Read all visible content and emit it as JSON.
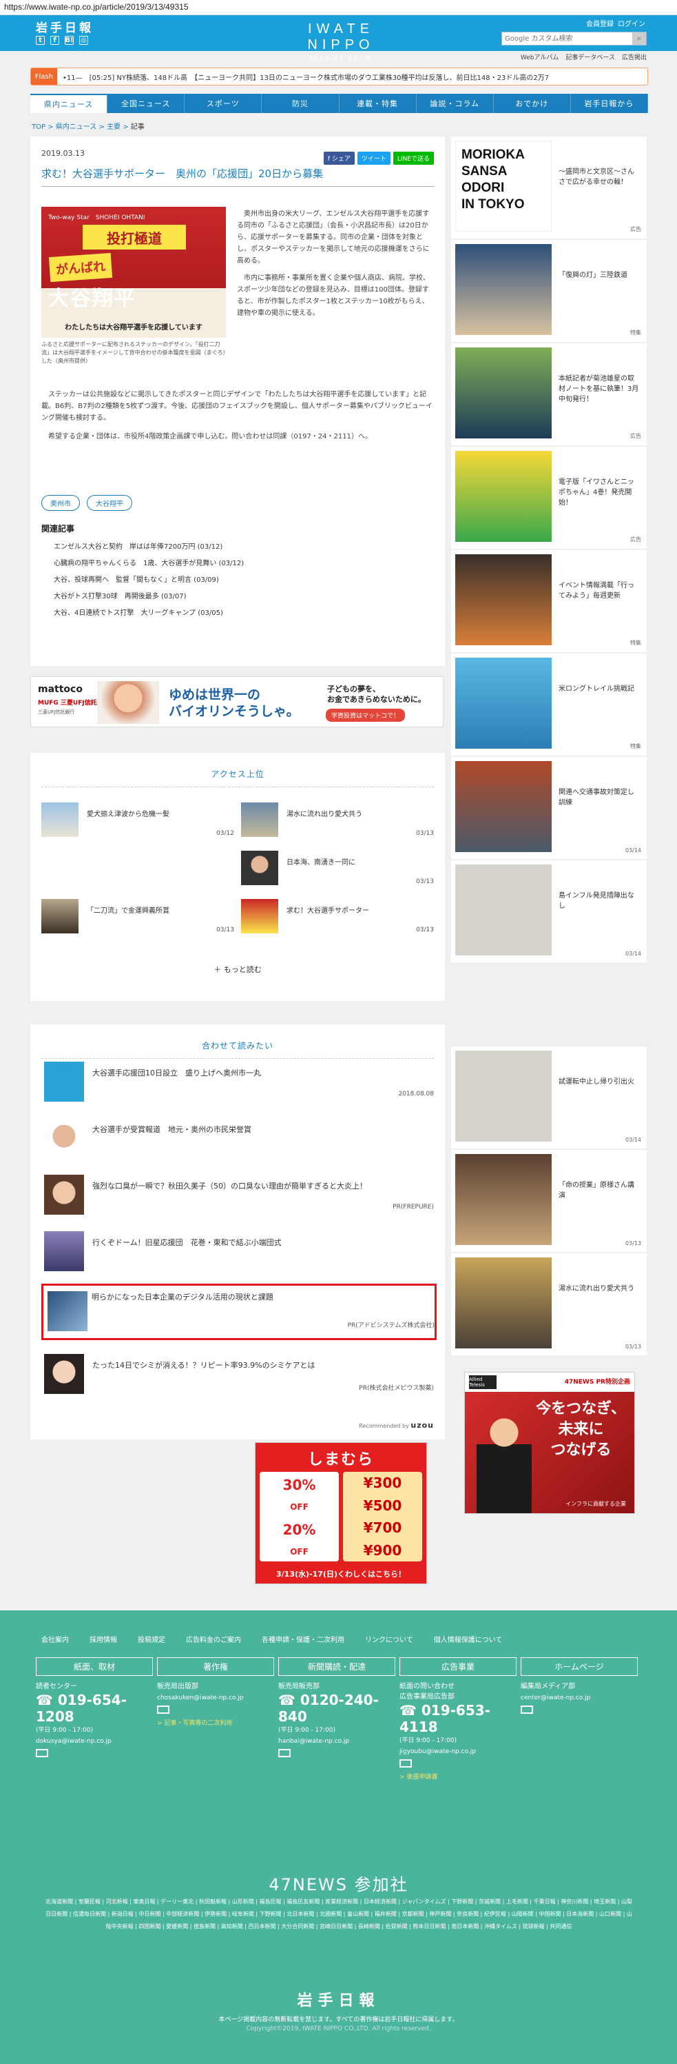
{
  "browser": {
    "url": "https://www.iwate-np.co.jp/article/2019/3/13/49315"
  },
  "header": {
    "logo_small": "岩手日報",
    "brand_name": "IWATE NIPPO",
    "brand_date": "2019.03.14. 木",
    "account_register": "会員登録",
    "account_login": "ログイン",
    "search_placeholder": "Google カスタム検索"
  },
  "subnav": [
    "Webアルバム",
    "記事データベース",
    "広告掲出"
  ],
  "flash": {
    "label": "Flash",
    "text": "•11—　[05:25] NY株続落、148ドル高　【ニューヨーク共同】13日のニューヨーク株式市場のダウ工業株30種平均は反落し、前日比148・23ドル高の2万7"
  },
  "mainnav": [
    "県内ニュース",
    "全国ニュース",
    "スポーツ",
    "防災",
    "連載・特集",
    "論説・コラム",
    "おでかけ",
    "岩手日報から"
  ],
  "breadcrumb": {
    "top": "TOP",
    "cat": "県内ニュース",
    "sub": "主要",
    "current": "記事"
  },
  "article": {
    "date": "2019.03.13",
    "share_fb": "f シェア",
    "share_tw": "ツイート",
    "share_line": "LINEで送る",
    "title": "求む！大谷選手サポーター　奥州の「応援団」20日から募集",
    "photo_texts": {
      "top": "Two-way Star　SHOHEI OHTANI",
      "banner": "投打極道",
      "ganbare": "がんばれ",
      "name": "大谷翔平",
      "bottom": "わたしたちは大谷翔平選手を応援しています"
    },
    "caption": "ふるさと応援サポーターに配布されるステッカーのデザイン。「投打二刀流」は大谷翔平選手をイメージして背中合わせの掛本籠度を意図（まぐろ）した（奥州市提供）",
    "body_right": [
      "奥州市出身の米大リーグ、エンゼルス大谷翔平選手を応援する同市の「ふるさと応援団」（会長・小沢昌記市長）は20日から、応援サポーターを募集する。同市の企業・団体を対象とし、ポスターやステッカーを掲示して地元の応援機運をさらに高める。",
      "市内に事務所・事業所を置く企業や個人商店、病院、学校、スポーツ少年団などの登録を見込み、目標は100団体。登録すると、市が作製したポスター1枚とステッカー10枚がもらえ、建物や車の掲示に使える。"
    ],
    "body_full": [
      "ステッカーは公共施設などに掲示してきたポスターと同じデザインで「わたしたちは大谷翔平選手を応援しています」と記載。B6判、B7判の2種類を5枚ずつ渡す。今後、応援団のフェイスブックを開設し、個人サポーター募集やパブリックビューイング開催も検討する。",
      "希望する企業・団体は、市役所4階政策企画課で申し込む。問い合わせは同課（0197・24・2111）へ。"
    ],
    "tags": [
      "奥州市",
      "大谷翔平"
    ],
    "related_heading": "関連記事",
    "related": [
      "エンゼルス大谷と契約　岸はは年俸7200万円 (03/12)",
      "心臓病の翔平ちゃんくらる　1歳、大谷選手が見舞い (03/12)",
      "大谷、投球再開へ　監督「間もなく」と明言 (03/09)",
      "大谷がトス打撃30球　再開後最多 (03/07)",
      "大谷、4日連続でトス打撃　大リーグキャンプ (03/05)"
    ]
  },
  "ad_banner": {
    "brand": "mattoco",
    "bank": "MUFG 三菱UFJ信託銀行",
    "note": "三菱UFJ信託銀行",
    "slogan": "ゆめは世界一の\nバイオリンそうしゃ。",
    "right_text": "子どもの夢を、\nお金であきらめないために。",
    "right_btn": "学資投資はマットコで！"
  },
  "ranking": {
    "title": "アクセス上位",
    "items": [
      {
        "title": "愛犬揃え津波から危機一髪",
        "date": "03/12"
      },
      {
        "title": "湯水に流れ出り愛犬共う",
        "date": "03/13"
      },
      {
        "title": "日本海、南湧き一同に",
        "date": "03/13"
      },
      {
        "title": "「二刀流」で金運興義所賞",
        "date": "03/13"
      },
      {
        "title": "求む！大谷選手サポーター",
        "date": "03/13"
      }
    ],
    "more": "＋ もっと読む"
  },
  "related_block": {
    "title": "合わせて読みたい",
    "items": [
      {
        "title": "大谷選手応援団10日設立　盛り上げへ奥州市一丸",
        "meta": "2018.08.08"
      },
      {
        "title": "大谷選手が受賞報道　地元・奥州の市民栄誉賞",
        "meta": ""
      },
      {
        "title": "強烈な口臭が一瞬で？秋田久美子（50）の口臭ない理由が簡単すぎると大炎上！",
        "meta": "PR(FREPURE)"
      },
      {
        "title": "行くぞドーム！旧星応援団　花巻・東和で結ぶ小端団式",
        "meta": ""
      },
      {
        "title": "明らかになった日本企業のデジタル活用の現状と課題",
        "meta": "PR(アドビシステムズ株式会社)"
      },
      {
        "title": "たった14日でシミが消える！？リピート率93.9%のシミケアとは",
        "meta": "PR(株式会社メビウス製薬)"
      }
    ],
    "credit_prefix": "Recommended by",
    "credit_brand": "uzou"
  },
  "sidebar": [
    {
      "title": "～盛岡市と文京区～さんさで広がる幸せの輪！",
      "tag": "広告"
    },
    {
      "title": "「復興の灯」三陸鉄道",
      "tag": "特集"
    },
    {
      "title": "本紙記者が菊池雄星の取材ノートを基に執筆！3月中旬発行！",
      "tag": "広告"
    },
    {
      "title": "電子版「イワさんとニッポちゃん」4巻！発売開始！",
      "tag": "広告"
    },
    {
      "title": "イベント情報満載「行ってみよう」毎週更新",
      "tag": "特集"
    },
    {
      "title": "米ロングトレイル挑戦記",
      "tag": "特集"
    },
    {
      "title": "関連へ交通事故対策定し訓練",
      "tag": "03/14"
    },
    {
      "title": "島インフル発見措陣出なし",
      "tag": "03/14"
    },
    {
      "title": "試運転中止し帰り引出火",
      "tag": "03/14"
    },
    {
      "title": "「命の授業」原様さん講演",
      "tag": "03/13"
    },
    {
      "title": "湯水に流れ出り愛犬共う",
      "tag": "03/13"
    }
  ],
  "side_ad": {
    "logo": "Allied Telesis",
    "pr": "47NEWS PR特別企画",
    "headline": "今をつなぎ、\n未来に\nつなげる",
    "sub": "インフラに貢献する企業"
  },
  "shimamura_ad": {
    "head": "しまむら",
    "left": [
      "30%",
      "OFF",
      "20%",
      "OFF"
    ],
    "right": [
      "¥300",
      "¥500",
      "¥700",
      "¥900"
    ],
    "foot": "3/13(水)-17(日)くわしくはこちら！"
  },
  "footer": {
    "links": [
      "会社案内",
      "採用情報",
      "投稿規定",
      "広告料金のご案内",
      "各種申請・保護・二次利用",
      "リンクについて",
      "個人情報保護について"
    ],
    "cols": [
      {
        "head": "紙面、取材",
        "title": "読者センター",
        "tel": "019-654-1208",
        "hours": "(平日 9:00 - 17:00)",
        "mail": "dokusya@iwate-np.co.jp",
        "extra": ""
      },
      {
        "head": "著作権",
        "title": "販売局出版部",
        "tel": "",
        "hours": "",
        "mail": "chosakuken@iwate-np.co.jp",
        "extra": "> 記事・写真等の二次利用"
      },
      {
        "head": "新聞購読・配達",
        "title": "販売局販売部",
        "tel": "0120-240-840",
        "hours": "(平日 9:00 - 17:00)",
        "mail": "hanbai@iwate-np.co.jp",
        "extra": ""
      },
      {
        "head": "広告事業",
        "title": "紙面の問い合わせ\n広告事業局広告部",
        "tel": "019-653-4118",
        "hours": "(平日 9:00 - 17:00)",
        "mail": "jigyoubu@iwate-np.co.jp",
        "extra": "> 後援申請書"
      },
      {
        "head": "ホームページ",
        "title": "編集局メディア部",
        "tel": "",
        "hours": "",
        "mail": "center@iwate-np.co.jp",
        "extra": ""
      }
    ],
    "news47": "47NEWS 参加社",
    "papers": "北海道新聞 | 室蘭民報 | 河北新報 | 東奥日報 | デーリー東北 | 秋田魁新報 | 山形新聞 | 福島民報 | 福島民友新聞 | 産業経済新聞 | 日本経済新聞 | ジャパンタイムズ | 下野新聞 | 茨城新聞 | 上毛新聞 | 千葉日報 | 神奈川新聞 | 埼玉新聞 | 山梨日日新聞 | 信濃毎日新聞 | 新潟日報 | 中日新聞 | 中部経済新聞 | 伊勢新聞 | 岐阜新聞 | 下野新聞 | 北日本新聞 | 北國新聞 | 富山新聞 | 福井新聞 | 京都新聞 | 神戸新聞 | 奈良新聞 | 紀伊民報 | 山陽新聞 | 中国新聞 | 日本海新聞 | 山口新聞 | 山陰中央新報 | 四国新聞 | 愛媛新聞 | 徳島新聞 | 高知新聞 | 西日本新聞 | 大分合同新聞 | 宮崎日日新聞 | 長崎新聞 | 佐賀新聞 | 熊本日日新聞 | 南日本新聞 | 沖縄タイムス | 琉球新報 | 共同通信",
    "logo": "岩手日報",
    "note": "本ページ掲載内容の無断転載を禁じます。すべての著作権は岩手日報社に帰属します。",
    "copyright": "Copyright©2019, IWATE NIPPO CO.,LTD. All rights reserved."
  },
  "colors": {
    "header_blue": "#1a9fd8",
    "nav_blue": "#1a7fbf",
    "footer_green": "#4ab59b",
    "flash_orange": "#f26a2b",
    "highlight_red": "#e0161b"
  }
}
